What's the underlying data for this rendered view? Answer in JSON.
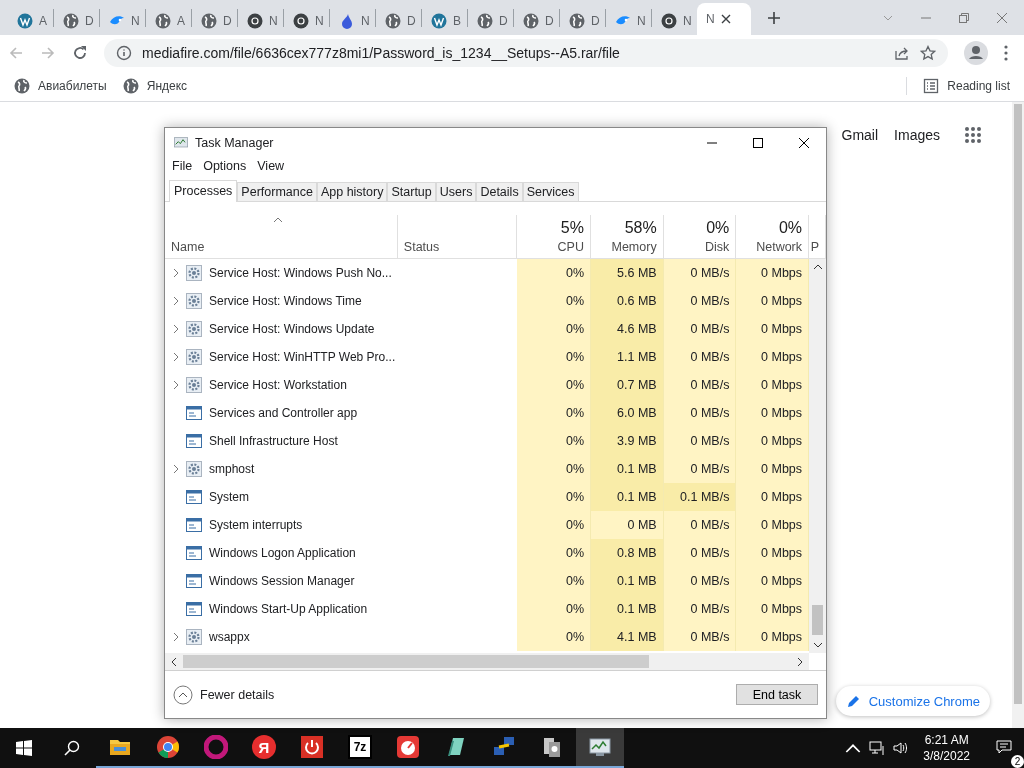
{
  "browser": {
    "tabs": [
      {
        "title": "A",
        "kind": "wp",
        "selected": false
      },
      {
        "title": "D",
        "kind": "globe",
        "selected": false
      },
      {
        "title": "N",
        "kind": "bird",
        "selected": false
      },
      {
        "title": "A",
        "kind": "globe",
        "selected": false
      },
      {
        "title": "D",
        "kind": "globe",
        "selected": false
      },
      {
        "title": "N",
        "kind": "chrome",
        "selected": false
      },
      {
        "title": "N",
        "kind": "chrome",
        "selected": false
      },
      {
        "title": "N",
        "kind": "drop",
        "selected": false
      },
      {
        "title": "D",
        "kind": "globe",
        "selected": false
      },
      {
        "title": "B",
        "kind": "wp",
        "selected": false
      },
      {
        "title": "D",
        "kind": "globe",
        "selected": false
      },
      {
        "title": "D",
        "kind": "globe",
        "selected": false
      },
      {
        "title": "D",
        "kind": "globe",
        "selected": false
      },
      {
        "title": "N",
        "kind": "bird",
        "selected": false
      },
      {
        "title": "N",
        "kind": "chrome",
        "selected": false
      },
      {
        "title": "N",
        "kind": "none",
        "selected": true
      }
    ],
    "url": "mediafire.com/file/6636cex777z8mi1/Password_is_1234__Setups--A5.rar/file",
    "bookmarks": [
      "Авиабилеты",
      "Яндекс"
    ],
    "reading_list": "Reading list",
    "page_links": [
      "Gmail",
      "Images"
    ],
    "customize_button": "Customize Chrome"
  },
  "task_manager": {
    "title": "Task Manager",
    "menu": [
      "File",
      "Options",
      "View"
    ],
    "tabs": [
      {
        "label": "Processes",
        "selected": true
      },
      {
        "label": "Performance",
        "selected": false
      },
      {
        "label": "App history",
        "selected": false
      },
      {
        "label": "Startup",
        "selected": false
      },
      {
        "label": "Users",
        "selected": false
      },
      {
        "label": "Details",
        "selected": false
      },
      {
        "label": "Services",
        "selected": false
      }
    ],
    "columns": [
      {
        "label": "Name"
      },
      {
        "label": "Status"
      },
      {
        "label": "CPU",
        "usage": "5%"
      },
      {
        "label": "Memory",
        "usage": "58%"
      },
      {
        "label": "Disk",
        "usage": "0%"
      },
      {
        "label": "Network",
        "usage": "0%"
      },
      {
        "label": "P"
      }
    ],
    "rows": [
      {
        "name": "Service Host: Windows Push No...",
        "kind": "service",
        "expandable": true,
        "cpu": "0%",
        "memory": "5.6 MB",
        "disk": "0 MB/s",
        "network": "0 Mbps",
        "memory_high": true,
        "disk_high": false
      },
      {
        "name": "Service Host: Windows Time",
        "kind": "service",
        "expandable": true,
        "cpu": "0%",
        "memory": "0.6 MB",
        "disk": "0 MB/s",
        "network": "0 Mbps",
        "memory_high": true,
        "disk_high": false
      },
      {
        "name": "Service Host: Windows Update",
        "kind": "service",
        "expandable": true,
        "cpu": "0%",
        "memory": "4.6 MB",
        "disk": "0 MB/s",
        "network": "0 Mbps",
        "memory_high": true,
        "disk_high": false
      },
      {
        "name": "Service Host: WinHTTP Web Pro...",
        "kind": "service",
        "expandable": true,
        "cpu": "0%",
        "memory": "1.1 MB",
        "disk": "0 MB/s",
        "network": "0 Mbps",
        "memory_high": true,
        "disk_high": false
      },
      {
        "name": "Service Host: Workstation",
        "kind": "service",
        "expandable": true,
        "cpu": "0%",
        "memory": "0.7 MB",
        "disk": "0 MB/s",
        "network": "0 Mbps",
        "memory_high": true,
        "disk_high": false
      },
      {
        "name": "Services and Controller app",
        "kind": "app",
        "expandable": false,
        "cpu": "0%",
        "memory": "6.0 MB",
        "disk": "0 MB/s",
        "network": "0 Mbps",
        "memory_high": true,
        "disk_high": false
      },
      {
        "name": "Shell Infrastructure Host",
        "kind": "app",
        "expandable": false,
        "cpu": "0%",
        "memory": "3.9 MB",
        "disk": "0 MB/s",
        "network": "0 Mbps",
        "memory_high": true,
        "disk_high": false
      },
      {
        "name": "smphost",
        "kind": "service",
        "expandable": true,
        "cpu": "0%",
        "memory": "0.1 MB",
        "disk": "0 MB/s",
        "network": "0 Mbps",
        "memory_high": true,
        "disk_high": false
      },
      {
        "name": "System",
        "kind": "app",
        "expandable": false,
        "cpu": "0%",
        "memory": "0.1 MB",
        "disk": "0.1 MB/s",
        "network": "0 Mbps",
        "memory_high": true,
        "disk_high": true
      },
      {
        "name": "System interrupts",
        "kind": "app",
        "expandable": false,
        "cpu": "0%",
        "memory": "0 MB",
        "disk": "0 MB/s",
        "network": "0 Mbps",
        "memory_high": false,
        "disk_high": false
      },
      {
        "name": "Windows Logon Application",
        "kind": "app",
        "expandable": false,
        "cpu": "0%",
        "memory": "0.8 MB",
        "disk": "0 MB/s",
        "network": "0 Mbps",
        "memory_high": true,
        "disk_high": false
      },
      {
        "name": "Windows Session Manager",
        "kind": "app",
        "expandable": false,
        "cpu": "0%",
        "memory": "0.1 MB",
        "disk": "0 MB/s",
        "network": "0 Mbps",
        "memory_high": true,
        "disk_high": false
      },
      {
        "name": "Windows Start-Up Application",
        "kind": "app",
        "expandable": false,
        "cpu": "0%",
        "memory": "0.1 MB",
        "disk": "0 MB/s",
        "network": "0 Mbps",
        "memory_high": true,
        "disk_high": false
      },
      {
        "name": "wsappx",
        "kind": "service",
        "expandable": true,
        "cpu": "0%",
        "memory": "4.1 MB",
        "disk": "0 MB/s",
        "network": "0 Mbps",
        "memory_high": true,
        "disk_high": false
      }
    ],
    "fewer_details": "Fewer details",
    "end_task": "End task"
  },
  "taskbar": {
    "apps": [
      {
        "kind": "folder",
        "selected": false
      },
      {
        "kind": "chrome",
        "selected": false
      },
      {
        "kind": "opera",
        "selected": false
      },
      {
        "kind": "yandex",
        "glyph": "Я",
        "selected": false
      },
      {
        "kind": "power",
        "selected": false
      },
      {
        "kind": "sevenzip",
        "glyph": "7z",
        "selected": false
      },
      {
        "kind": "gauge",
        "selected": false
      },
      {
        "kind": "notepad",
        "selected": false
      },
      {
        "kind": "network",
        "selected": false
      },
      {
        "kind": "installer",
        "selected": false
      },
      {
        "kind": "taskmgr",
        "selected": true
      }
    ],
    "time": "6:21 AM",
    "date": "3/8/2022",
    "notifications": "2"
  }
}
